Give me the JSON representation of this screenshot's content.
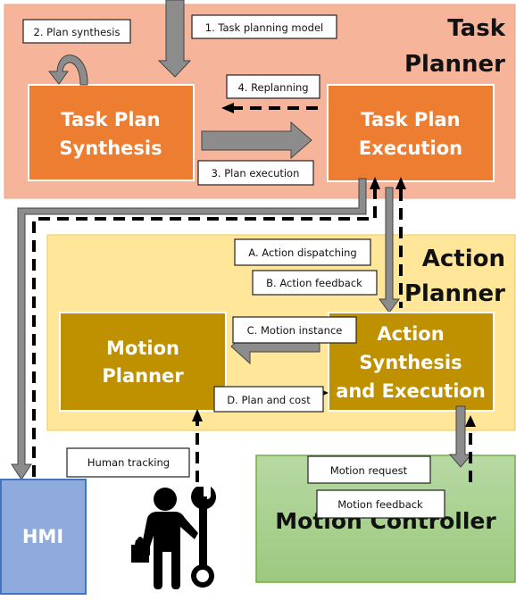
{
  "task_planner": {
    "title_line1": "Task",
    "title_line2": "Planner",
    "synthesis_line1": "Task Plan",
    "synthesis_line2": "Synthesis",
    "execution_line1": "Task Plan",
    "execution_line2": "Execution",
    "labels": {
      "task_planning_model": "1. Task planning model",
      "plan_synthesis": "2. Plan synthesis",
      "plan_execution": "3. Plan execution",
      "replanning": "4. Replanning"
    }
  },
  "action_planner": {
    "title_line1": "Action",
    "title_line2": "Planner",
    "motion_planner_line1": "Motion",
    "motion_planner_line2": "Planner",
    "action_line1": "Action",
    "action_line2": "Synthesis",
    "action_line3": "and Execution",
    "labels": {
      "action_dispatching": "A. Action dispatching",
      "action_feedback": "B. Action feedback",
      "motion_instance": "C. Motion instance",
      "plan_and_cost": "D. Plan and cost"
    }
  },
  "hmi": {
    "label": "HMI"
  },
  "human": {
    "label": "Human tracking",
    "icon": "worker-with-wrench-icon"
  },
  "motion_controller": {
    "title": "Motion Controller",
    "labels": {
      "motion_request": "Motion request",
      "motion_feedback": "Motion feedback"
    }
  },
  "colors": {
    "task_planner_bg": "#f6b49b",
    "task_box": "#ed7d31",
    "action_planner_bg": "#ffe699",
    "action_box": "#bf9000",
    "hmi": "#8faadc",
    "motion_controller": "#a9d18e"
  }
}
